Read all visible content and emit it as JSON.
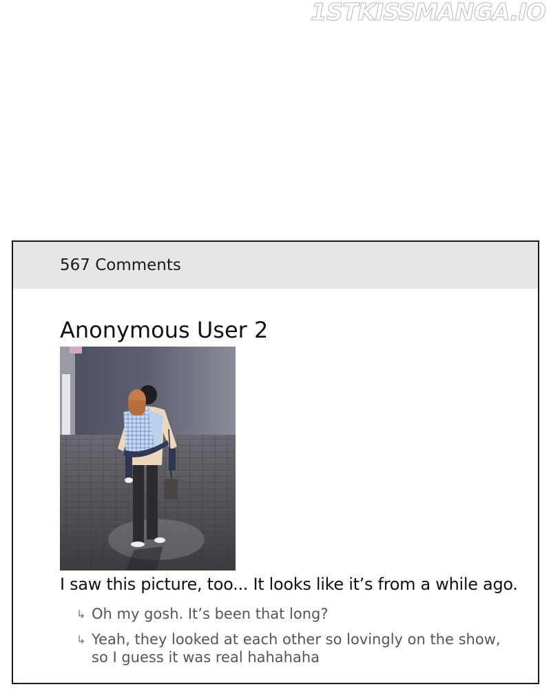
{
  "watermark": "1STKISSMANGA.IO",
  "comments_panel": {
    "count_label": "567 Comments",
    "comment": {
      "username": "Anonymous User 2",
      "image": "couple-walking-photo",
      "text": "I saw this picture, too... It looks like it’s from a while ago.",
      "replies": [
        {
          "icon": "reply-arrow-icon",
          "text": "Oh my gosh. It’s been that long?"
        },
        {
          "icon": "reply-arrow-icon",
          "text": "Yeah, they looked at each other so lovingly on the show,\nso I guess it was real hahahaha"
        }
      ]
    }
  },
  "colors": {
    "header_bg": "#e6e6e6",
    "border": "#1a1a1a",
    "reply_text": "#555555"
  }
}
